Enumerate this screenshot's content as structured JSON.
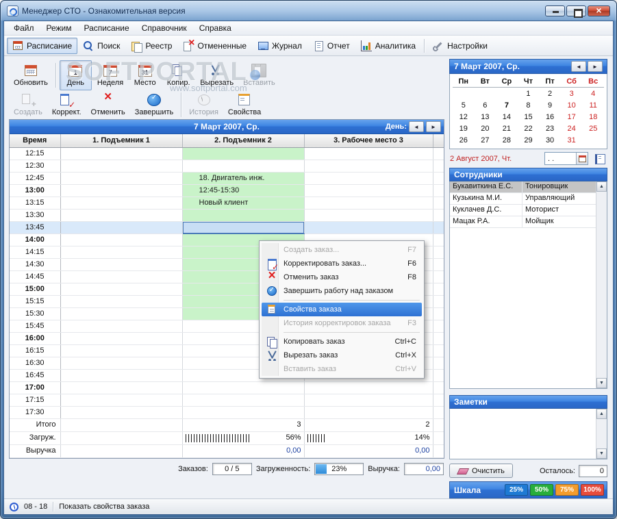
{
  "window": {
    "title": "Менеджер СТО - Ознакомительная версия"
  },
  "watermark": {
    "text": "SOFTPORTAL",
    "url": "www.softportal.com"
  },
  "menu": {
    "items": [
      {
        "label": "Файл",
        "name": "file"
      },
      {
        "label": "Режим",
        "name": "mode"
      },
      {
        "label": "Расписание",
        "name": "schedule"
      },
      {
        "label": "Справочник",
        "name": "reference"
      },
      {
        "label": "Справка",
        "name": "help"
      }
    ]
  },
  "toolbar_main": {
    "items": [
      {
        "label": "Расписание",
        "name": "schedule",
        "icon": "schedule",
        "active": true
      },
      {
        "label": "Поиск",
        "name": "search",
        "icon": "search"
      },
      {
        "label": "Реестр",
        "name": "registry",
        "icon": "registry"
      },
      {
        "label": "Отмененные",
        "name": "cancelled",
        "icon": "cancelled"
      },
      {
        "label": "Журнал",
        "name": "journal",
        "icon": "journal"
      },
      {
        "label": "Отчет",
        "name": "report",
        "icon": "report"
      },
      {
        "label": "Аналитика",
        "name": "analytics",
        "icon": "analytics"
      },
      {
        "label": "Настройки",
        "name": "settings",
        "icon": "settings",
        "separated": true
      }
    ]
  },
  "toolbar_view": {
    "refresh_label": "Обновить",
    "badges": {
      "day": "1",
      "week": "7",
      "place": "31"
    },
    "items": [
      {
        "label": "День",
        "name": "day",
        "icon": "day",
        "active": true
      },
      {
        "label": "Неделя",
        "name": "week",
        "icon": "week"
      },
      {
        "label": "Место",
        "name": "place",
        "icon": "place"
      },
      {
        "label": "Копир.",
        "name": "copy",
        "icon": "copy"
      },
      {
        "label": "Вырезать",
        "name": "cut",
        "icon": "cut"
      },
      {
        "label": "Вставить",
        "name": "paste",
        "icon": "paste",
        "disabled": true
      }
    ]
  },
  "toolbar_order": {
    "items": [
      {
        "label": "Создать",
        "name": "create",
        "icon": "create",
        "disabled": true
      },
      {
        "label": "Коррект.",
        "name": "correct",
        "icon": "correct"
      },
      {
        "label": "Отменить",
        "name": "cancel",
        "icon": "cancel"
      },
      {
        "label": "Завершить",
        "name": "complete",
        "icon": "complete"
      },
      {
        "label": "История",
        "name": "history",
        "icon": "history",
        "disabled": true,
        "separated": true
      },
      {
        "label": "Свойства",
        "name": "properties",
        "icon": "properties"
      }
    ]
  },
  "date_band": {
    "title": "7 Март 2007, Ср.",
    "mode_label": "День:"
  },
  "schedule": {
    "columns": [
      "Время",
      "1. Подъемник 1",
      "2. Подъемник 2",
      "3. Рабочее место 3"
    ],
    "times": [
      "12:15",
      "12:30",
      "12:45",
      "13:00",
      "13:15",
      "13:30",
      "13:45",
      "14:00",
      "14:15",
      "14:30",
      "14:45",
      "15:00",
      "15:15",
      "15:30",
      "15:45",
      "16:00",
      "16:15",
      "16:30",
      "16:45",
      "17:00",
      "17:15",
      "17:30"
    ],
    "selected_time": "13:45",
    "appointment": {
      "column_index": 1,
      "green_times": [
        "12:15",
        "12:45",
        "13:00",
        "13:15",
        "13:30",
        "14:00",
        "14:15",
        "14:30",
        "14:45",
        "15:00",
        "15:15",
        "15:30"
      ],
      "lines": {
        "12:45": "18. Двигатель инж.",
        "13:00": "12:45-15:30",
        "13:15": "Новый клиент"
      }
    },
    "summary": {
      "total": {
        "label": "Итого",
        "values": [
          "",
          "3",
          "2"
        ]
      },
      "load": {
        "label": "Загруж.",
        "values": [
          "",
          "56%",
          "14%"
        ]
      },
      "revenue": {
        "label": "Выручка",
        "values": [
          "",
          "0,00",
          "0,00"
        ]
      }
    }
  },
  "footer": {
    "orders_label": "Заказов:",
    "orders_value": "0 / 5",
    "load_label": "Загруженность:",
    "load_value": "23%",
    "revenue_label": "Выручка:",
    "revenue_value": "0,00"
  },
  "context_menu": {
    "items": [
      {
        "label": "Создать заказ...",
        "name": "create-order",
        "shortcut": "F7",
        "disabled": true
      },
      {
        "label": "Корректировать заказ...",
        "name": "edit-order",
        "shortcut": "F6",
        "icon": "correct"
      },
      {
        "label": "Отменить заказ",
        "name": "cancel-order",
        "shortcut": "F8",
        "icon": "cancel"
      },
      {
        "label": "Завершить работу над заказом",
        "name": "complete-order",
        "icon": "complete"
      },
      {
        "separator": true
      },
      {
        "label": "Свойства заказа",
        "name": "order-properties",
        "icon": "properties",
        "highlighted": true
      },
      {
        "label": "История корректировок заказа",
        "name": "order-history",
        "shortcut": "F3",
        "disabled": true
      },
      {
        "separator": true
      },
      {
        "label": "Копировать заказ",
        "name": "copy-order",
        "shortcut": "Ctrl+C",
        "icon": "copy"
      },
      {
        "label": "Вырезать заказ",
        "name": "cut-order",
        "shortcut": "Ctrl+X",
        "icon": "cut"
      },
      {
        "label": "Вставить заказ",
        "name": "paste-order",
        "shortcut": "Ctrl+V",
        "disabled": true
      }
    ]
  },
  "calendar": {
    "header": "7 Март 2007, Ср.",
    "weekdays": [
      "Пн",
      "Вт",
      "Ср",
      "Чт",
      "Пт",
      "Сб",
      "Вс"
    ],
    "weeks": [
      [
        "",
        "",
        "",
        "1",
        "2",
        "3",
        "4"
      ],
      [
        "5",
        "6",
        "7",
        "8",
        "9",
        "10",
        "11"
      ],
      [
        "12",
        "13",
        "14",
        "15",
        "16",
        "17",
        "18"
      ],
      [
        "19",
        "20",
        "21",
        "22",
        "23",
        "24",
        "25"
      ],
      [
        "26",
        "27",
        "28",
        "29",
        "30",
        "31",
        ""
      ]
    ],
    "selected_day": "7",
    "goto_label": "2 Август 2007, Чт.",
    "goto_value": ".  ."
  },
  "employees": {
    "header": "Сотрудники",
    "rows": [
      {
        "name": "Букавиткина Е.С.",
        "role": "Тонировщик",
        "selected": true
      },
      {
        "name": "Кузькина М.И.",
        "role": "Управляющий"
      },
      {
        "name": "Куклачев Д.С.",
        "role": "Моторист"
      },
      {
        "name": "Мацак Р.А.",
        "role": "Мойщик"
      }
    ]
  },
  "notes": {
    "header": "Заметки",
    "clear_label": "Очистить",
    "remaining_label": "Осталось:",
    "remaining_value": "0"
  },
  "scale": {
    "header": "Шкала",
    "levels": [
      {
        "label": "25%",
        "color": "#1e7ad4"
      },
      {
        "label": "50%",
        "color": "#27ae3c"
      },
      {
        "label": "75%",
        "color": "#f39c2c"
      },
      {
        "label": "100%",
        "color": "#e74c3c"
      }
    ]
  },
  "statusbar": {
    "hours": "08 - 18",
    "hint": "Показать свойства заказа"
  }
}
